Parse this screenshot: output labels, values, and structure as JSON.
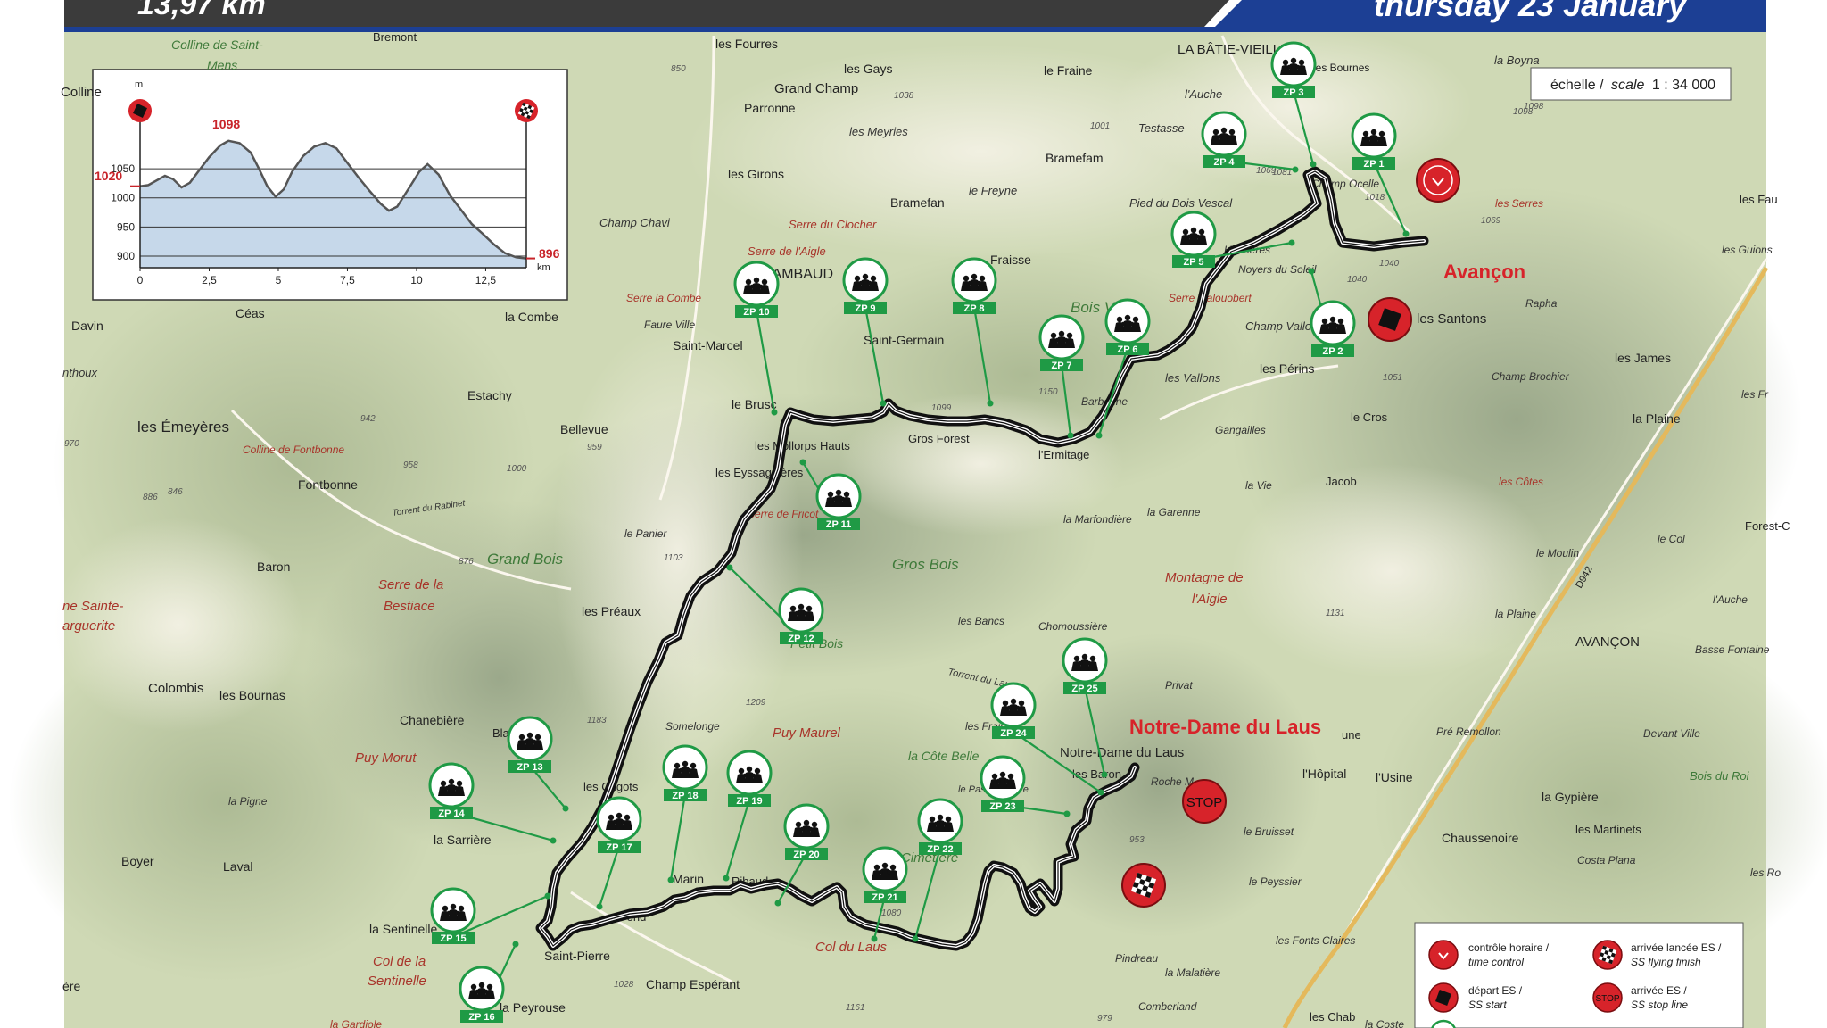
{
  "header": {
    "distance": "13,97 km",
    "date": "thursday 23 January"
  },
  "scale": {
    "label_fr": "échelle /",
    "label_en": "scale",
    "value": "1 : 34 000"
  },
  "profile": {
    "y_unit": "m",
    "x_unit": "km",
    "y_ticks": [
      "1050",
      "1000",
      "950",
      "900"
    ],
    "x_ticks": [
      "0",
      "2,5",
      "5",
      "7,5",
      "10",
      "12,5"
    ],
    "start_alt": "1020",
    "max_alt": "1098",
    "end_alt": "896",
    "elevation": [
      [
        0,
        1020
      ],
      [
        0.3,
        1022
      ],
      [
        0.6,
        1030
      ],
      [
        0.9,
        1038
      ],
      [
        1.2,
        1032
      ],
      [
        1.5,
        1018
      ],
      [
        1.8,
        1026
      ],
      [
        2.1,
        1045
      ],
      [
        2.5,
        1070
      ],
      [
        2.9,
        1090
      ],
      [
        3.2,
        1098
      ],
      [
        3.6,
        1094
      ],
      [
        4.0,
        1078
      ],
      [
        4.3,
        1050
      ],
      [
        4.6,
        1020
      ],
      [
        4.9,
        1002
      ],
      [
        5.2,
        1015
      ],
      [
        5.5,
        1045
      ],
      [
        5.9,
        1072
      ],
      [
        6.3,
        1088
      ],
      [
        6.7,
        1094
      ],
      [
        7.1,
        1085
      ],
      [
        7.5,
        1060
      ],
      [
        7.9,
        1035
      ],
      [
        8.3,
        1012
      ],
      [
        8.7,
        990
      ],
      [
        9.0,
        978
      ],
      [
        9.3,
        985
      ],
      [
        9.7,
        1015
      ],
      [
        10.1,
        1045
      ],
      [
        10.4,
        1058
      ],
      [
        10.8,
        1040
      ],
      [
        11.2,
        1005
      ],
      [
        11.6,
        980
      ],
      [
        12.0,
        955
      ],
      [
        12.4,
        938
      ],
      [
        12.8,
        920
      ],
      [
        13.2,
        905
      ],
      [
        13.6,
        898
      ],
      [
        13.97,
        896
      ]
    ]
  },
  "places": {
    "labatie": "LA BÂTIE-VIEILLE",
    "bremont": "Bremont",
    "colline_st": "Colline de Saint-",
    "mens": "Mens",
    "colline": "Colline",
    "les_fourres": "les Fourres",
    "les_gays": "les Gays",
    "grand_champ": "Grand Champ",
    "parronne": "Parronne",
    "les_meyries": "les Meyries",
    "le_fraine": "le Fraine",
    "l_auche": "l'Auche",
    "testasse": "Testasse",
    "les_bournes": "les Bournes",
    "la_boyna": "la Boyna",
    "bramefam": "Bramefam",
    "bramefan": "Bramefan",
    "le_freyne": "le Freyne",
    "pied_bois": "Pied du Bois Vescal",
    "champ_ocelle": "Champ Ocelle",
    "les_girons": "les Girons",
    "champ_chavi": "Champ Chavi",
    "serre_clocher": "Serre du Clocher",
    "serre_aigle": "Serre de l'Aigle",
    "rambaud": "RAMBAUD",
    "fraisse": "Fraisse",
    "bois_v": "Bois V",
    "serre_malo": "Serre Malouobert",
    "hourieres": "Hourières",
    "noyers": "Noyers du Soleil",
    "les_serres": "les Serres",
    "les_fau": "les Fau",
    "les_guions": "les Guions",
    "avancon_red": "Avançon",
    "les_santons": "les Santons",
    "rapha": "Rapha",
    "serre_combe": "Serre la Combe",
    "faure_ville": "Faure Ville",
    "saint_marcel": "Saint-Marcel",
    "saint_germain": "Saint-Germain",
    "champ_vallon": "Champ Vallon",
    "les_vallons": "les Vallons",
    "les_perins": "les Périns",
    "champ_brochier": "Champ Brochier",
    "les_james": "les James",
    "ceas": "Céas",
    "davin": "Davin",
    "la_combe": "la Combe",
    "nthoux": "nthoux",
    "estachy": "Estachy",
    "barbonne": "Barbonne",
    "le_cros": "le Cros",
    "la_plaine": "la Plaine",
    "les_fr": "les Fr",
    "les_emeyeres": "les Émeyères",
    "bellevue": "Bellevue",
    "le_brusc": "le Brusc",
    "les_mollorps": "les Mollorps Hauts",
    "gros_forest": "Gros Forest",
    "l_ermitage": "l'Ermitage",
    "gangailles": "Gangailles",
    "colline_fontbonne": "Colline de Fontbonne",
    "fontbonne": "Fontbonne",
    "les_eyssagnieres": "les Eyssagnières",
    "jacob": "Jacob",
    "la_vie": "la Vie",
    "les_cotes": "les Côtes",
    "torrent_rabinet": "Torrent du Rabinet",
    "serre_fricot": "Serre de Fricot",
    "la_marfondiere": "la Marfondière",
    "la_garenne": "la Garenne",
    "forest_c": "Forest-C",
    "baron": "Baron",
    "grand_bois": "Grand Bois",
    "le_panier": "le Panier",
    "gros_bois": "Gros Bois",
    "le_col": "le Col",
    "le_moulin": "le Moulin",
    "montagne_aigle1": "Montagne de",
    "montagne_aigle2": "l'Aigle",
    "serre_bestiace1": "Serre de la",
    "serre_bestiace2": "Bestiace",
    "l_auche2": "l'Auche",
    "d942": "D942",
    "ne_sainte1": "ne Sainte-",
    "ne_sainte2": "arguerite",
    "les_preaux": "les Préaux",
    "petit_bois": "Petit Bois",
    "la_plaine2": "la Plaine",
    "les_bancs": "les Bancs",
    "chomoussiere": "Chomoussière",
    "avancon": "AVANÇON",
    "basse_fontaine": "Basse Fontaine",
    "colombis": "Colombis",
    "les_bournas": "les Bournas",
    "torrent_laus": "Torrent du Laus",
    "privat": "Privat",
    "chanebiere": "Chanebière",
    "blache": "Blache",
    "somelonge": "Somelonge",
    "puy_maurel": "Puy Maurel",
    "les_fraisses": "les Fraisses",
    "ndl_red": "Notre-Dame du Laus",
    "ndl": "Notre-Dame du Laus",
    "une": "une",
    "pre_remollon": "Pré Remollon",
    "devant_ville": "Devant Ville",
    "puy_morut": "Puy Morut",
    "les_cagots": "les Cagots",
    "la_cote_belle": "la Côte Belle",
    "les_baron": "les Baron",
    "roche_m": "Roche M",
    "l_hopital": "l'Hôpital",
    "l_usine": "l'Usine",
    "bois_du_roi": "Bois du Roi",
    "la_pigne": "la Pigne",
    "le_pas": "le Pas du Lièvre",
    "la_gypiere": "la Gypière",
    "la_sarriere": "la Sarrière",
    "le_bruisset": "le Bruisset",
    "chaussenoire": "Chaussenoire",
    "les_martinets": "les Martinets",
    "boyer": "Boyer",
    "laval": "Laval",
    "costa_plana": "Costa Plana",
    "marin": "Marin",
    "ribaud": "Ribaud",
    "cimetiere": "Cimetière",
    "le_peyssier": "le Peyssier",
    "les_ro": "les Ro",
    "la_sentinelle": "la Sentinelle",
    "pond": "Pond",
    "col_sentinelle1": "Col de la",
    "col_sentinelle2": "Sentinelle",
    "saint_pierre": "Saint-Pierre",
    "col_du_laus": "Col du Laus",
    "les_fonts_claires": "les Fonts Claires",
    "pindreau": "Pindreau",
    "la_malatiere": "la Malatière",
    "ere": "ère",
    "champ_esperant": "Champ Espérant",
    "la_peyrouse": "la Peyrouse",
    "comberland": "Comberland",
    "les_chab": "les Chab",
    "la_gardiole": "la Gardiole",
    "la_coste": "la Coste"
  },
  "altitudes": [
    "850",
    "1038",
    "1001",
    "1069",
    "1081",
    "1018",
    "1040",
    "1051",
    "1069",
    "1098",
    "1040",
    "1099",
    "1150",
    "942",
    "959",
    "958",
    "1000",
    "970",
    "846",
    "886",
    "876",
    "1183",
    "1103",
    "1209",
    "1161",
    "1080",
    "953",
    "1131",
    "979",
    "975",
    "1098",
    "1028"
  ],
  "zp_prefix": "ZP",
  "zps": [
    "1",
    "2",
    "3",
    "4",
    "5",
    "6",
    "7",
    "8",
    "9",
    "10",
    "11",
    "12",
    "13",
    "14",
    "15",
    "16",
    "17",
    "18",
    "19",
    "20",
    "21",
    "22",
    "23",
    "24",
    "25"
  ],
  "markers": {
    "stop": "STOP"
  },
  "legend": {
    "time_control_fr": "contrôle horaire /",
    "time_control_en": "time control",
    "flying_finish_fr": "arrivée lancée ES /",
    "flying_finish_en": "SS flying finish",
    "ss_start_fr": "départ ES /",
    "ss_start_en": "SS start",
    "stop_line_fr": "arrivée ES /",
    "stop_line_en": "SS stop line",
    "stop_icon": "STOP"
  },
  "colors": {
    "header_dark": "#3b3b3b",
    "header_blue": "#1c3f94",
    "marker_red": "#d7232a",
    "zp_green": "#1f9a45",
    "route": "#111111"
  }
}
